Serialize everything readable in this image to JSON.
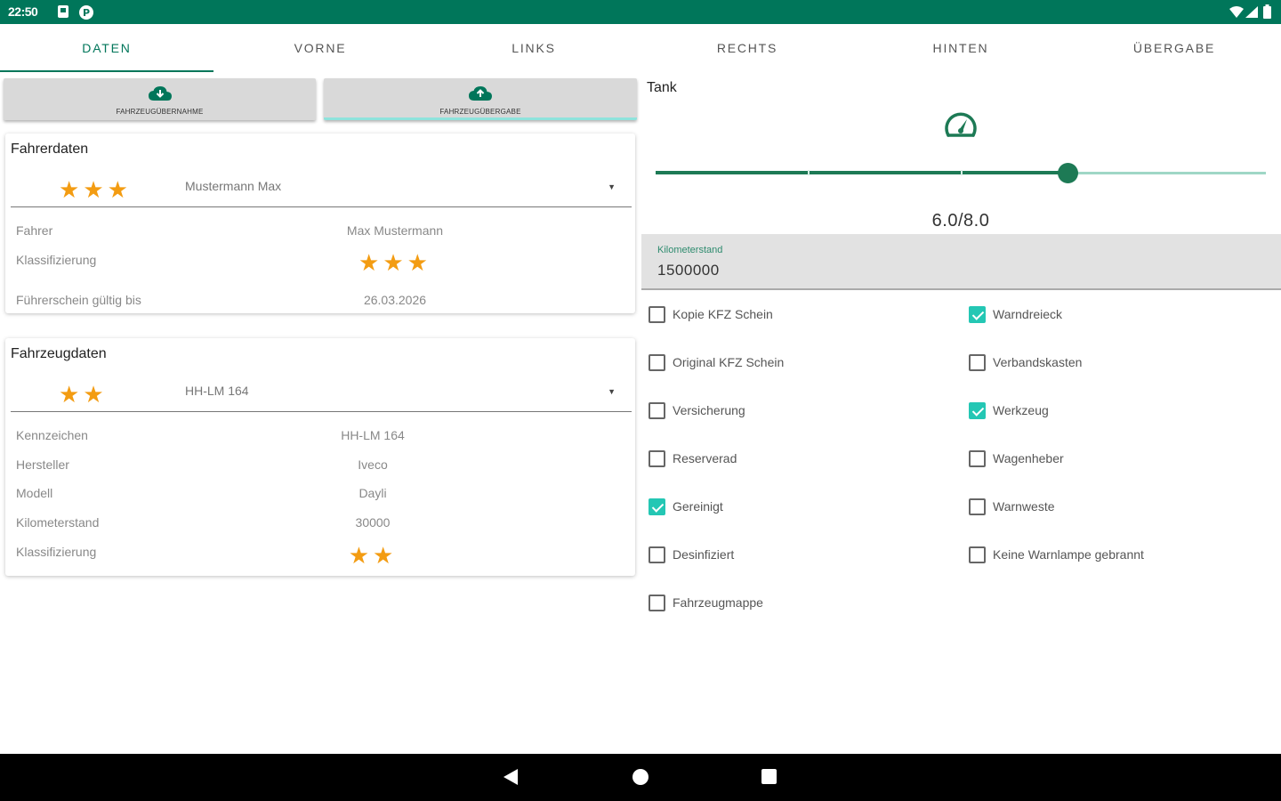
{
  "status_bar": {
    "time": "22:50"
  },
  "tabs": [
    {
      "label": "DATEN",
      "active": true
    },
    {
      "label": "VORNE",
      "active": false
    },
    {
      "label": "LINKS",
      "active": false
    },
    {
      "label": "RECHTS",
      "active": false
    },
    {
      "label": "HINTEN",
      "active": false
    },
    {
      "label": "ÜBERGABE",
      "active": false
    }
  ],
  "actions": {
    "pickup_label": "FAHRZEUGÜBERNAHME",
    "handover_label": "FAHRZEUGÜBERGABE"
  },
  "driver_card": {
    "title": "Fahrerdaten",
    "selected": "Mustermann Max",
    "selected_rating": 3,
    "fields": [
      {
        "label": "Fahrer",
        "value": "Max Mustermann"
      },
      {
        "label": "Klassifizierung",
        "rating": 3
      },
      {
        "label": "Führerschein gültig bis",
        "value": "26.03.2026"
      }
    ]
  },
  "vehicle_card": {
    "title": "Fahrzeugdaten",
    "selected": "HH-LM 164",
    "selected_rating": 2,
    "fields": [
      {
        "label": "Kennzeichen",
        "value": "HH-LM 164"
      },
      {
        "label": "Hersteller",
        "value": "Iveco"
      },
      {
        "label": "Modell",
        "value": "Dayli"
      },
      {
        "label": "Kilometerstand",
        "value": "30000"
      },
      {
        "label": "Klassifizierung",
        "rating": 2
      }
    ]
  },
  "tank": {
    "title": "Tank",
    "value_text": "6.0/8.0",
    "level": 6.0,
    "max": 8.0,
    "accent_color": "#1d7a55"
  },
  "odometer": {
    "label": "Kilometerstand",
    "value": "1500000"
  },
  "checklist_left": [
    {
      "label": "Kopie KFZ Schein",
      "checked": false
    },
    {
      "label": "Original KFZ Schein",
      "checked": false
    },
    {
      "label": "Versicherung",
      "checked": false
    },
    {
      "label": "Reserverad",
      "checked": false
    },
    {
      "label": "Gereinigt",
      "checked": true
    },
    {
      "label": "Desinfiziert",
      "checked": false
    },
    {
      "label": "Fahrzeugmappe",
      "checked": false
    }
  ],
  "checklist_right": [
    {
      "label": "Warndreieck",
      "checked": true
    },
    {
      "label": "Verbandskasten",
      "checked": false
    },
    {
      "label": "Werkzeug",
      "checked": true
    },
    {
      "label": "Wagenheber",
      "checked": false
    },
    {
      "label": "Warnweste",
      "checked": false
    },
    {
      "label": "Keine Warnlampe gebrannt",
      "checked": false
    }
  ],
  "colors": {
    "primary": "#00765a",
    "star": "#f39c12",
    "checkbox_checked": "#24c7b4"
  },
  "icons": {
    "pickup": "cloud-download-icon",
    "handover": "cloud-upload-icon",
    "tank": "speedometer-icon"
  }
}
